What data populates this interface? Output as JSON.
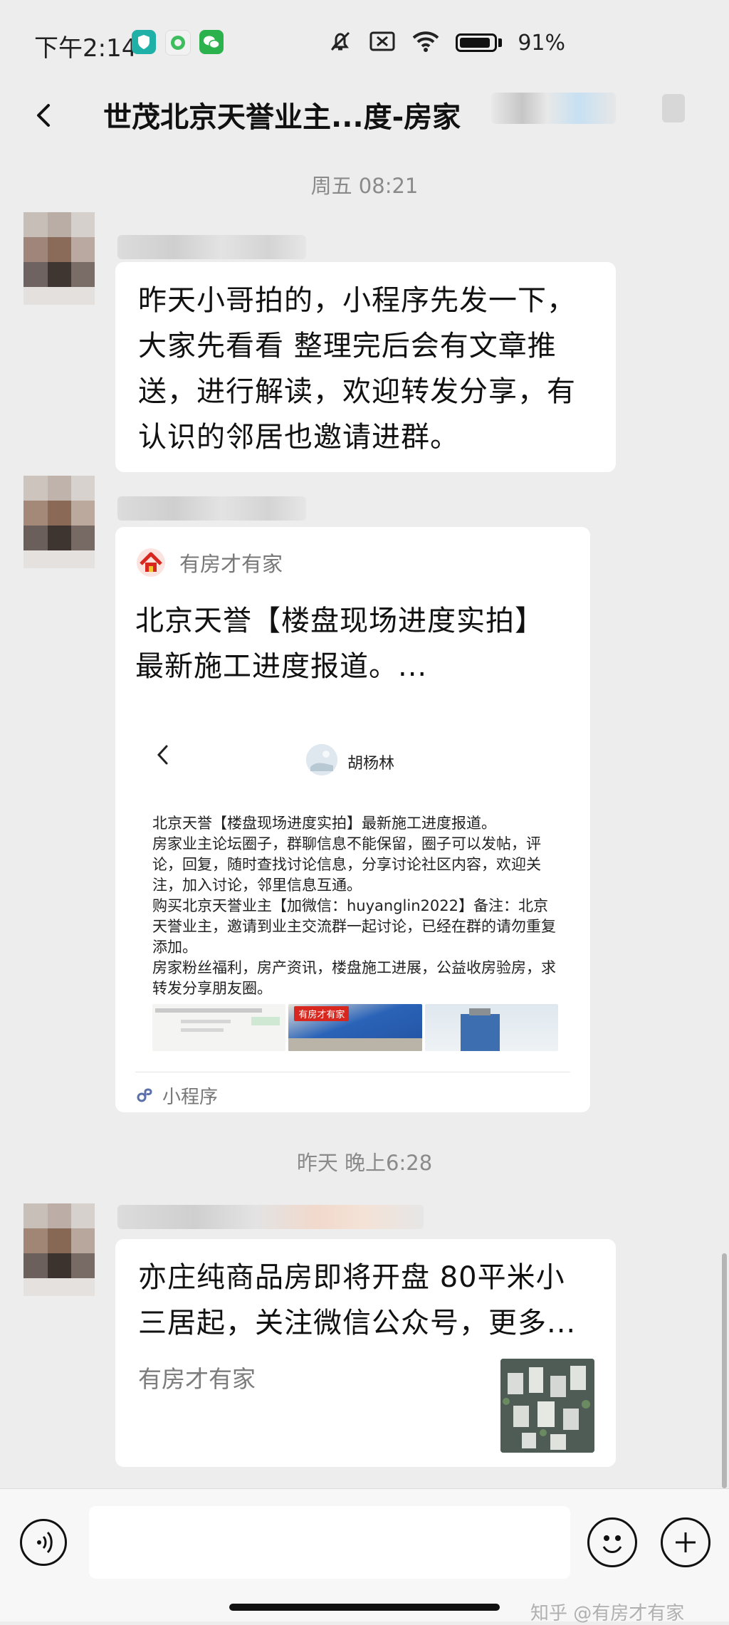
{
  "status_bar": {
    "time": "下午2:14",
    "battery": "91%",
    "battery_level": 0.91
  },
  "nav": {
    "title": "世茂北京天誉业主...度-房家"
  },
  "messages": [
    {
      "timestamp": "周五 08:21",
      "text": "昨天小哥拍的，小程序先发一下，大家先看看 整理完后会有文章推送，进行解读，欢迎转发分享，有认识的邻居也邀请进群。"
    },
    {
      "mini_program": {
        "source": "有房才有家",
        "title": "北京天誉【楼盘现场进度实拍】最新施工进度报道。...",
        "preview_name": "胡杨林",
        "preview_body": "北京天誉【楼盘现场进度实拍】最新施工进度报道。\n房家业主论坛圈子，群聊信息不能保留，圈子可以发帖，评论，回复，随时查找讨论信息，分享讨论社区内容，欢迎关注，加入讨论，邻里信息互通。\n购买北京天誉业主【加微信：huyanglin2022】备注：北京天誉业主，邀请到业主交流群一起讨论，已经在群的请勿重复添加。\n房家粉丝福利，房产资讯，楼盘施工进展，公益收房验房，求转发分享朋友圈。",
        "thumb_caption": "有房才有家",
        "footer": "小程序"
      }
    },
    {
      "timestamp": "昨天 晚上6:28",
      "article": {
        "title": "亦庄纯商品房即将开盘 80平米小三居起，关注微信公众号，更多...",
        "source": "有房才有家"
      }
    }
  ],
  "watermark": "知乎 @有房才有家"
}
